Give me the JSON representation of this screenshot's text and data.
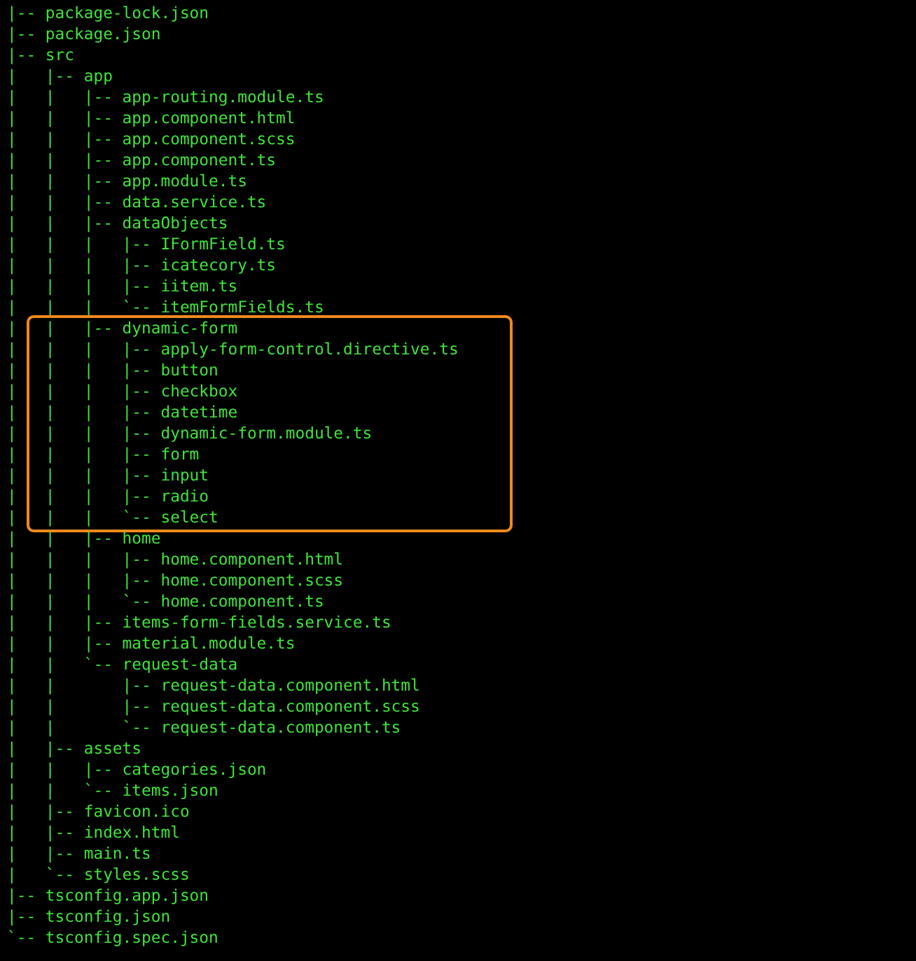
{
  "terminal": {
    "blocks": [
      {
        "highlighted": false,
        "lines": [
          "|-- package-lock.json",
          "|-- package.json",
          "|-- src",
          "|   |-- app",
          "|   |   |-- app-routing.module.ts",
          "|   |   |-- app.component.html",
          "|   |   |-- app.component.scss",
          "|   |   |-- app.component.ts",
          "|   |   |-- app.module.ts",
          "|   |   |-- data.service.ts",
          "|   |   |-- dataObjects",
          "|   |   |   |-- IFormField.ts",
          "|   |   |   |-- icatecory.ts",
          "|   |   |   |-- iitem.ts",
          "|   |   |   `-- itemFormFields.ts"
        ]
      },
      {
        "highlighted": true,
        "lines": [
          "|   |   |-- dynamic-form",
          "|   |   |   |-- apply-form-control.directive.ts",
          "|   |   |   |-- button",
          "|   |   |   |-- checkbox",
          "|   |   |   |-- datetime",
          "|   |   |   |-- dynamic-form.module.ts",
          "|   |   |   |-- form",
          "|   |   |   |-- input",
          "|   |   |   |-- radio",
          "|   |   |   `-- select"
        ]
      },
      {
        "highlighted": false,
        "lines": [
          "|   |   |-- home",
          "|   |   |   |-- home.component.html",
          "|   |   |   |-- home.component.scss",
          "|   |   |   `-- home.component.ts",
          "|   |   |-- items-form-fields.service.ts",
          "|   |   |-- material.module.ts",
          "|   |   `-- request-data",
          "|   |       |-- request-data.component.html",
          "|   |       |-- request-data.component.scss",
          "|   |       `-- request-data.component.ts",
          "|   |-- assets",
          "|   |   |-- categories.json",
          "|   |   `-- items.json",
          "|   |-- favicon.ico",
          "|   |-- index.html",
          "|   |-- main.ts",
          "|   `-- styles.scss",
          "|-- tsconfig.app.json",
          "|-- tsconfig.json",
          "`-- tsconfig.spec.json"
        ]
      }
    ]
  }
}
